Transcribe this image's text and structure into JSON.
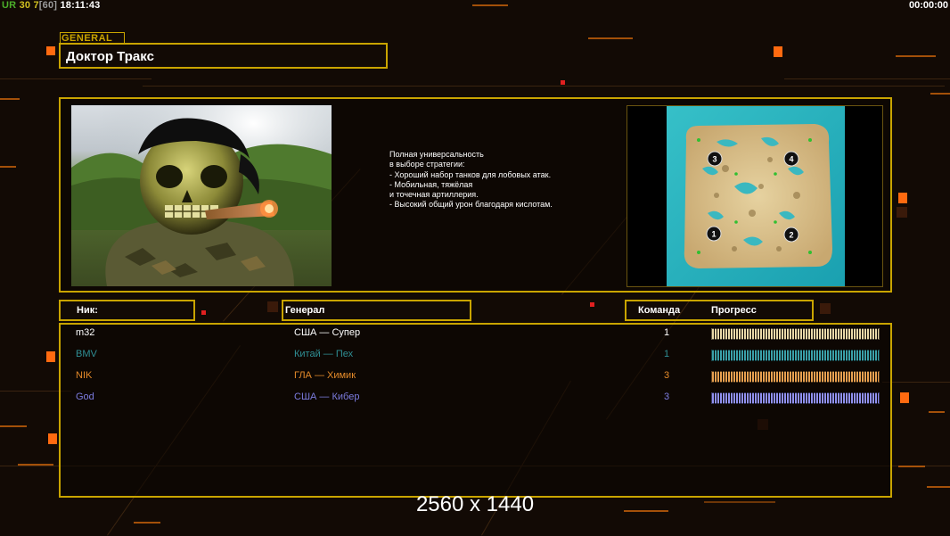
{
  "hud": {
    "ur": "UR",
    "fps": "30",
    "fps_cur": "7",
    "fps_max": "[60]",
    "clock": "18:11:43",
    "timer": "00:00:00"
  },
  "general": {
    "tag": "GENERAL",
    "name": "Доктор Тракс",
    "description": [
      "Полная универсальность",
      "в выборе стратегии:",
      "",
      "- Хороший набор танков для лобовых атак.",
      "",
      "- Мобильная, тяжёлая",
      "и точечная артиллерия.",
      "",
      "- Высокий общий урон благодаря кислотам."
    ]
  },
  "map": {
    "spawns": [
      "1",
      "2",
      "3",
      "4"
    ]
  },
  "table": {
    "headers": {
      "nick": "Ник:",
      "general": "Генерал",
      "team": "Команда",
      "progress": "Прогресс"
    },
    "rows": [
      {
        "nick": "m32",
        "general": "США — Супер",
        "team": "1",
        "color": "#ffffff",
        "progress": 1.0,
        "bar_color": "#e8d8a8"
      },
      {
        "nick": "BMV",
        "general": "Китай — Пех",
        "team": "1",
        "color": "#2f8f95",
        "progress": 1.0,
        "bar_color": "#3aa0a8"
      },
      {
        "nick": "NIK",
        "general": "ГЛА — Химик",
        "team": "3",
        "color": "#e48a2a",
        "progress": 1.0,
        "bar_color": "#e8a050"
      },
      {
        "nick": "God",
        "general": "США — Кибер",
        "team": "3",
        "color": "#7c7ce0",
        "progress": 1.0,
        "bar_color": "#9090f0"
      }
    ]
  },
  "resolution": "2560 x 1440",
  "colors": {
    "accent": "#c9a400",
    "background": "#120a05",
    "highlight": "#ff6a10"
  }
}
